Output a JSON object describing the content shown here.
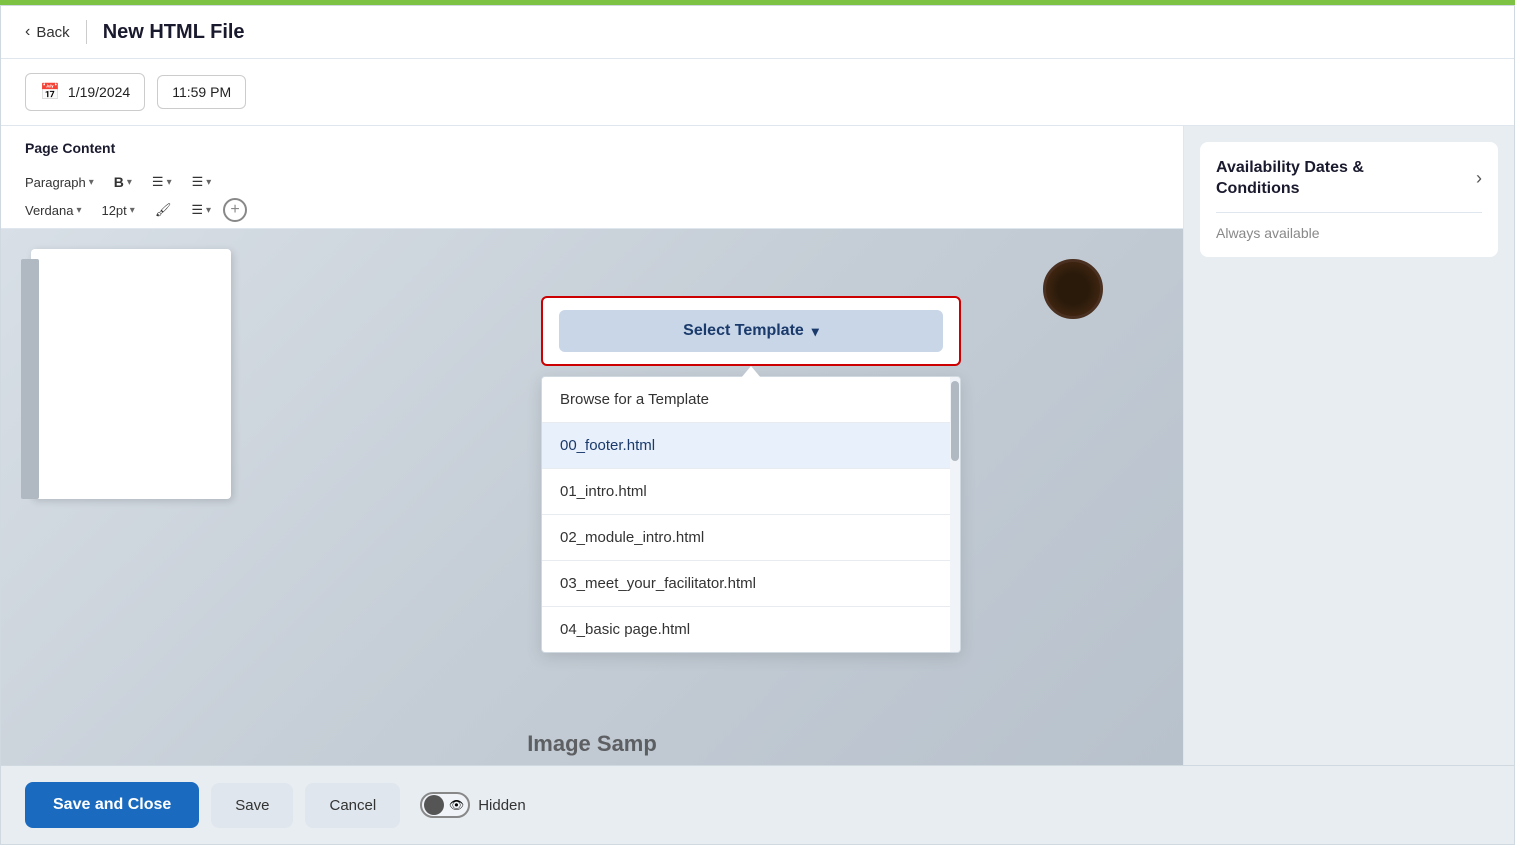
{
  "topbar": {
    "color": "#7dc242"
  },
  "header": {
    "back_label": "Back",
    "title": "New HTML File"
  },
  "datetime": {
    "date_value": "1/19/2024",
    "time_value": "11:59 PM"
  },
  "editor": {
    "page_content_label": "Page Content",
    "toolbar_row1": {
      "paragraph_label": "Paragraph",
      "bold_label": "B",
      "align_label": "≡",
      "list_label": "≡"
    },
    "toolbar_row2": {
      "font_label": "Verdana",
      "size_label": "12pt",
      "paint_icon": "🖌",
      "more_icon": "≡"
    },
    "image_caption": "Image Samp"
  },
  "select_template": {
    "button_label": "Select Template",
    "chevron": "▾",
    "browse_label": "Browse for a Template",
    "items": [
      {
        "id": "footer",
        "label": "00_footer.html",
        "active": true
      },
      {
        "id": "intro",
        "label": "01_intro.html",
        "active": false
      },
      {
        "id": "module_intro",
        "label": "02_module_intro.html",
        "active": false
      },
      {
        "id": "facilitator",
        "label": "03_meet_your_facilitator.html",
        "active": false
      },
      {
        "id": "basic",
        "label": "04_basic page.html",
        "active": false
      }
    ]
  },
  "sidebar": {
    "section_title": "Availability Dates &\nConditions",
    "section_value": "Always available"
  },
  "footer": {
    "save_close_label": "Save and Close",
    "save_label": "Save",
    "cancel_label": "Cancel",
    "hidden_label": "Hidden"
  }
}
